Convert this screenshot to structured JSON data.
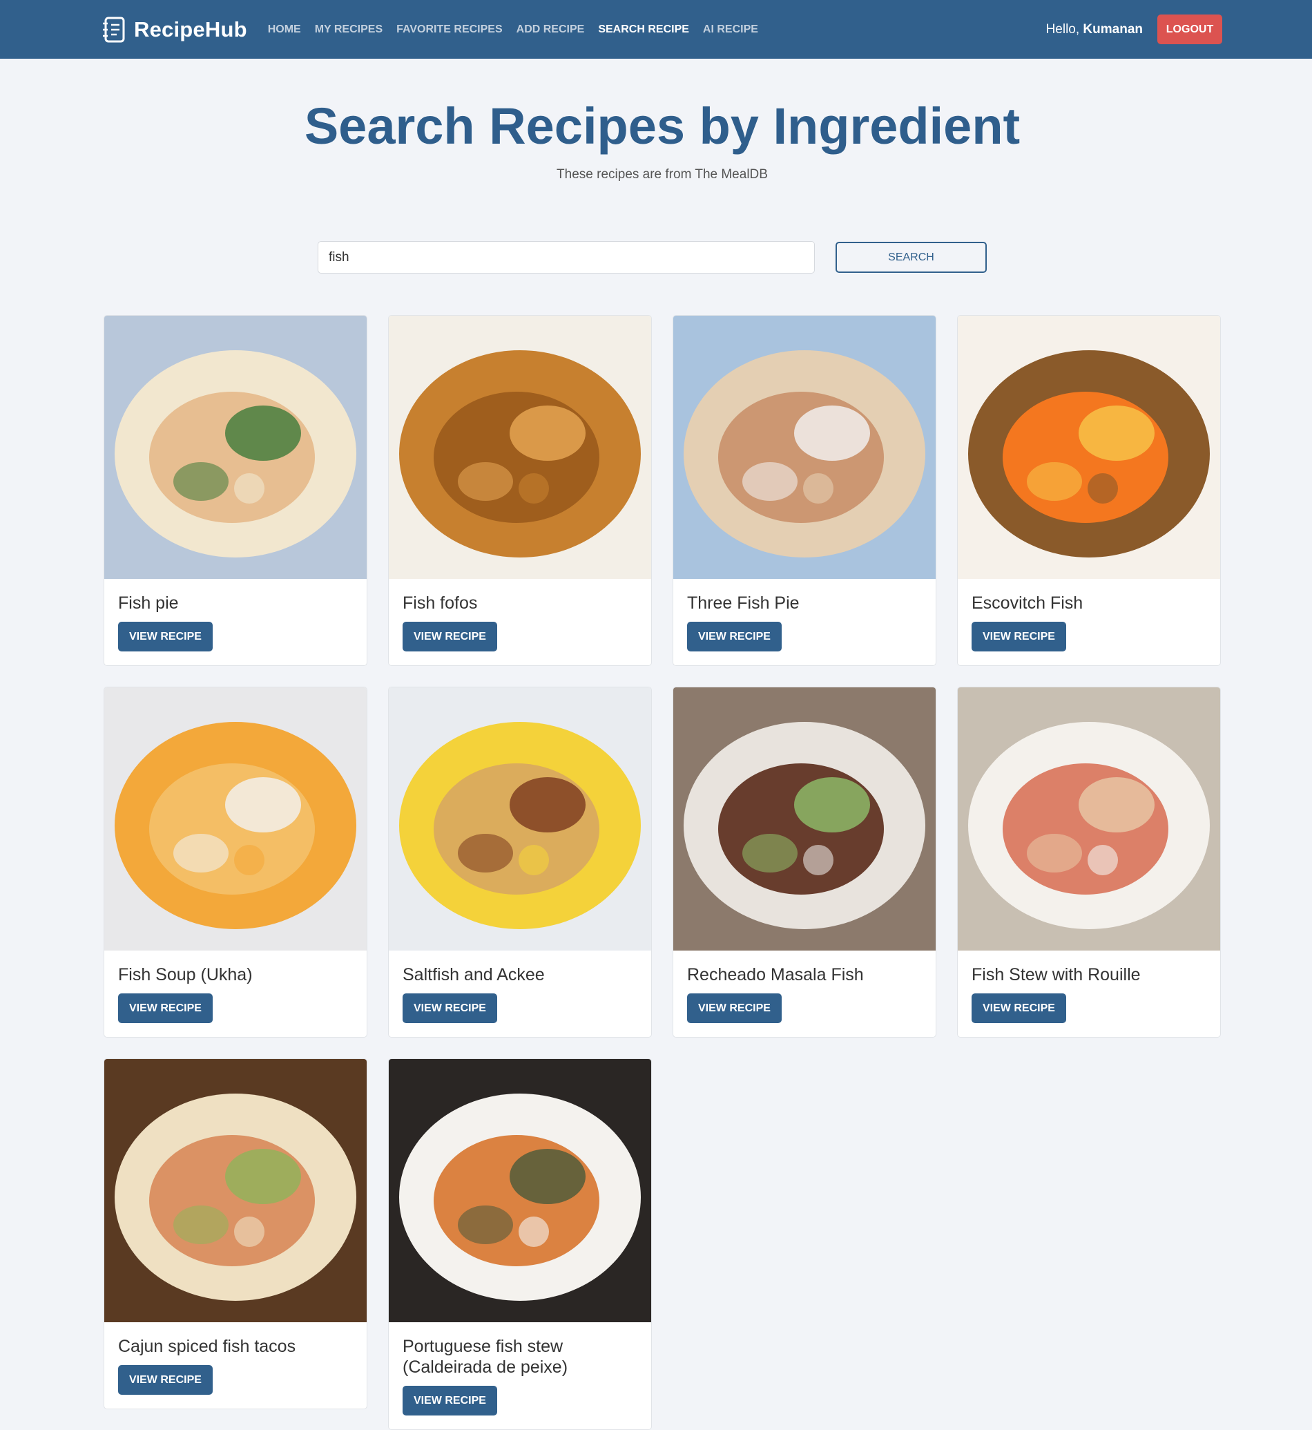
{
  "navbar": {
    "brand": "RecipeHub",
    "links": [
      {
        "label": "HOME",
        "active": false
      },
      {
        "label": "MY RECIPES",
        "active": false
      },
      {
        "label": "FAVORITE RECIPES",
        "active": false
      },
      {
        "label": "ADD RECIPE",
        "active": false
      },
      {
        "label": "SEARCH RECIPE",
        "active": true
      },
      {
        "label": "AI RECIPE",
        "active": false
      }
    ],
    "greeting_prefix": "Hello, ",
    "user_name": "Kumanan",
    "logout_label": "LOGOUT"
  },
  "hero": {
    "title": "Search Recipes by Ingredient",
    "subtitle": "These recipes are from The MealDB"
  },
  "search": {
    "value": "fish",
    "button_label": "SEARCH"
  },
  "recipes": [
    {
      "title": "Fish pie",
      "button_label": "VIEW RECIPE",
      "palette": [
        "#b8c7da",
        "#f2e7cf",
        "#e6b98a",
        "#3f7a3a"
      ]
    },
    {
      "title": "Fish fofos",
      "button_label": "VIEW RECIPE",
      "palette": [
        "#f3efe7",
        "#c7802f",
        "#9a5a1c",
        "#e8a855"
      ]
    },
    {
      "title": "Three Fish Pie",
      "button_label": "VIEW RECIPE",
      "palette": [
        "#a9c3de",
        "#e4cfb3",
        "#c9906a",
        "#f4f4f4"
      ]
    },
    {
      "title": "Escovitch Fish",
      "button_label": "VIEW RECIPE",
      "palette": [
        "#f6f1ea",
        "#8a5a2a",
        "#ff7a1e",
        "#f7c64a"
      ]
    },
    {
      "title": "Fish Soup (Ukha)",
      "button_label": "VIEW RECIPE",
      "palette": [
        "#e8e8ea",
        "#f3a83a",
        "#f4c06a",
        "#f2f2f2"
      ]
    },
    {
      "title": "Saltfish and Ackee",
      "button_label": "VIEW RECIPE",
      "palette": [
        "#e9ecf0",
        "#f4d23a",
        "#d8a760",
        "#7a3a1e"
      ]
    },
    {
      "title": "Recheado Masala Fish",
      "button_label": "VIEW RECIPE",
      "palette": [
        "#8c7a6c",
        "#e8e3dd",
        "#5a2a1a",
        "#8fbf6a"
      ]
    },
    {
      "title": "Fish Stew with Rouille",
      "button_label": "VIEW RECIPE",
      "palette": [
        "#c8bfb2",
        "#f4f1ec",
        "#d9735a",
        "#e9c8a6"
      ]
    },
    {
      "title": "Cajun spiced fish tacos",
      "button_label": "VIEW RECIPE",
      "palette": [
        "#5a3a22",
        "#efe0c2",
        "#d88a5a",
        "#8fb45a"
      ]
    },
    {
      "title": "Portuguese fish stew (Caldeirada de peixe)",
      "button_label": "VIEW RECIPE",
      "palette": [
        "#2a2624",
        "#f4f2ee",
        "#d8752e",
        "#4a5a3a"
      ]
    }
  ]
}
